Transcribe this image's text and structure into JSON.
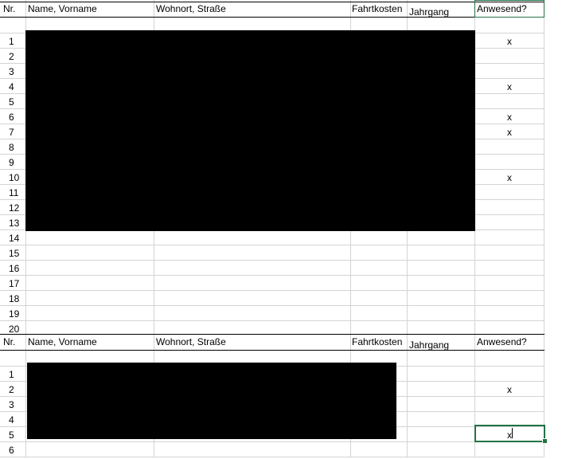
{
  "section1": {
    "headers": {
      "nr": "Nr.",
      "name": "Name, Vorname",
      "wohnort": "Wohnort, Straße",
      "fahrtkosten": "Fahrtkosten",
      "jahrgang": "Jahrgang",
      "anwesend": "Anwesend?"
    },
    "rows": [
      "1",
      "2",
      "3",
      "4",
      "5",
      "6",
      "7",
      "8",
      "9",
      "10",
      "11",
      "12",
      "13",
      "14",
      "15",
      "16",
      "17",
      "18",
      "19",
      "20"
    ],
    "anwesend_marks": {
      "r1": "x",
      "r4": "x",
      "r6": "x",
      "r7": "x",
      "r10": "x"
    }
  },
  "section2": {
    "headers": {
      "nr": "Nr.",
      "name": "Name, Vorname",
      "wohnort": "Wohnort, Straße",
      "fahrtkosten": "Fahrtkosten",
      "jahrgang": "Jahrgang",
      "anwesend": "Anwesend?"
    },
    "rows": [
      "1",
      "2",
      "3",
      "4",
      "5",
      "6"
    ],
    "anwesend_marks": {
      "r2": "x",
      "r5": "x"
    }
  }
}
